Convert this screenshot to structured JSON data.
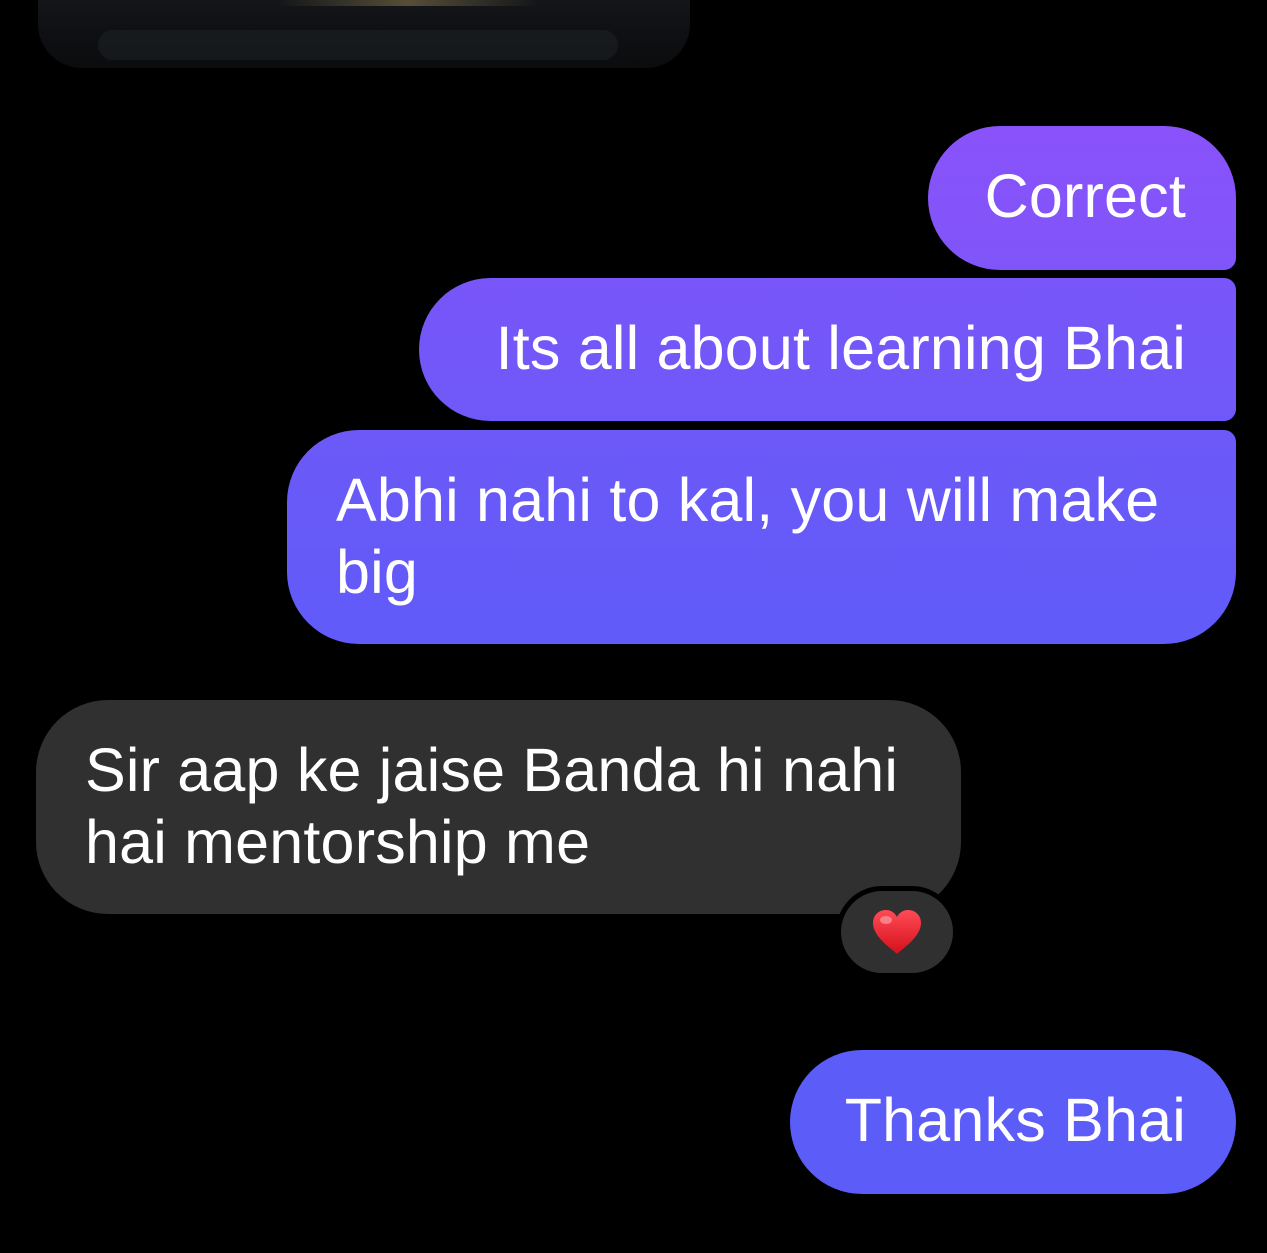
{
  "conversation": {
    "shared_media_thumbnail": "media-preview",
    "messages": [
      {
        "direction": "sent",
        "text": "Correct"
      },
      {
        "direction": "sent",
        "text": "Its all about learning Bhai"
      },
      {
        "direction": "sent",
        "text": "Abhi nahi to kal, you will make big"
      },
      {
        "direction": "received",
        "text": "Sir aap ke jaise Banda hi nahi hai mentorship me",
        "reaction": "heart-icon"
      },
      {
        "direction": "sent",
        "text": "Thanks Bhai"
      }
    ]
  },
  "colors": {
    "background": "#000000",
    "sent_gradient_top": "#8a52fb",
    "sent_gradient_bottom": "#5c5cf9",
    "received_bubble": "#303030",
    "reaction_heart": "#e8202a",
    "text": "#ffffff"
  }
}
